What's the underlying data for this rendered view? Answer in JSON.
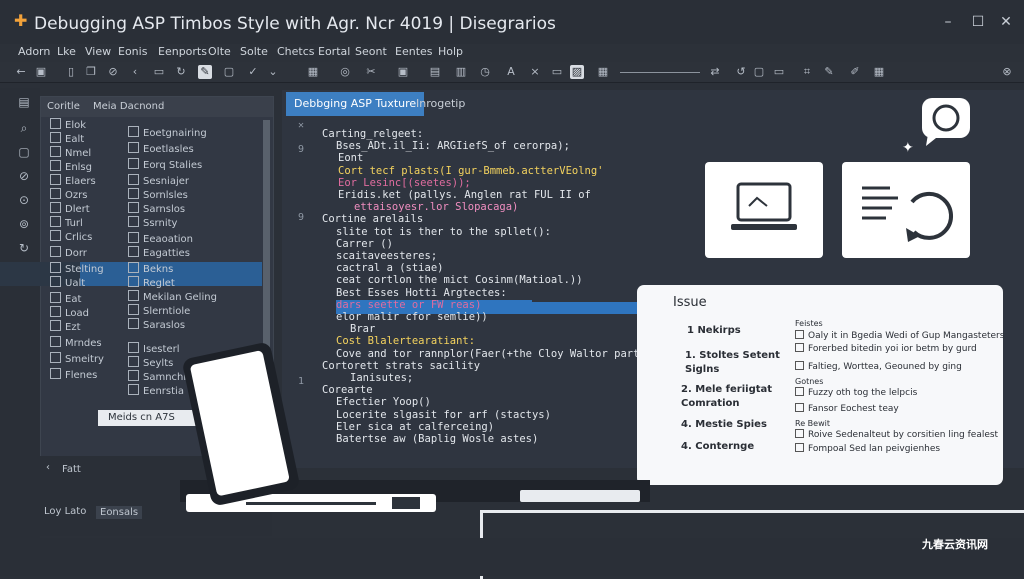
{
  "window": {
    "title": "Debugging ASP Timbos Style with Agr. Ncr 4019  |  Disegrarios",
    "minimize": "–",
    "maximize": "☐",
    "close": "✕"
  },
  "menu": [
    "Adorn",
    "Lke",
    "View",
    "Eonis",
    "Eenports",
    "Olte",
    "Solte",
    "Chetcs",
    "Eortal",
    "Seont",
    "Eentes",
    "Holp"
  ],
  "explorer": {
    "tabs": [
      "Coritle",
      "Meia Dacnond"
    ],
    "left_items": [
      "Elok",
      "Ealt",
      "Nmel",
      "Enlsg",
      "Elaers",
      "Ozrs",
      "Dlert",
      "Turl",
      "Crlics",
      "Dorr",
      "Stelting",
      "Ualt",
      "Eat",
      "Load",
      "Ezt",
      "Mrndes",
      "Smeitry",
      "Flenes"
    ],
    "right_items": [
      "Eoetgnairing",
      "Eoetlasles",
      "Eorq Stalies",
      "Sesniajer",
      "Sornlsles",
      "Sarnslos",
      "Ssrnity",
      "Eeaoation",
      "Eagatties",
      "Bekns",
      "Reglet",
      "Mekilan Geling",
      "Slerntiole",
      "Saraslos",
      "Isesterl",
      "Seylts",
      "Samnchig",
      "Eenrstia"
    ],
    "tooltip": "Meids cn A7S"
  },
  "bottom_left": {
    "tab": "Fatt",
    "label": "Loy Lato",
    "value": "Eonsals"
  },
  "editor": {
    "tabs": [
      "Debbging ASP Tuxture",
      "Inrogetip"
    ],
    "code_lines": [
      "Carting_relgeet:",
      "Bses_ADt.il_Ii: ARGIiefS_of cerorpa);",
      "Eont",
      "Cort tecf plasts(I gur-Bmmeb.actterVEolng'",
      "Eor Lesinc[(seetes));",
      "Eridis.ket (pallys. Anglen rat FUL II of",
      "   ettaisoyesr.lor Slopacaga)",
      "Cortine arelails",
      "  slite tot is ther to the spllet():",
      "  Carrer ()",
      "     scaitaveesteres;",
      "     cactral a (stiae)",
      "     ceat cortlon the mict Cosinm(Matioal.))",
      "     Best Esses Hotti Argtectes:",
      "     dars seette or FW reas)",
      "     elor malir cfor semlie))",
      "     Brar",
      "Cost Blalertearatiant:",
      "Cove and tor rannplor(Faer(+the Cloy Waltor partngt",
      "Cortorett strats sacility",
      "     Ianisutes;",
      "Corearte",
      "  Efectier Yoop()",
      "  Locerite slgasit for arf (stactys)",
      "  Eler sica at calferceing)",
      "  Batertse aw (Baplig Wosle astes)"
    ]
  },
  "issue": {
    "title": "Issue",
    "steps": [
      "1  Nekirps",
      "1.  Stoltes Setent Siglns",
      "2.  Mele feriigtat Comration",
      "4.  Mestie Spies",
      "4.  Conternge"
    ],
    "checks": [
      "Feistes",
      "Oaly it in Bgedia Wedi of Gup Mangasteters",
      "Forerbed bitedin yoi ior betm by gurd",
      "Faltieg, Worttea, Geouned by ging",
      "Gotnes",
      "Fuzzy oth tog the lelpcis",
      "Fansor Eochest teay",
      "Re Bewit",
      "Roive Sedenalteut by corsitien ling fealest",
      "Fompoal Sed lan peivgienhes"
    ]
  },
  "watermark": "九春云资讯网"
}
